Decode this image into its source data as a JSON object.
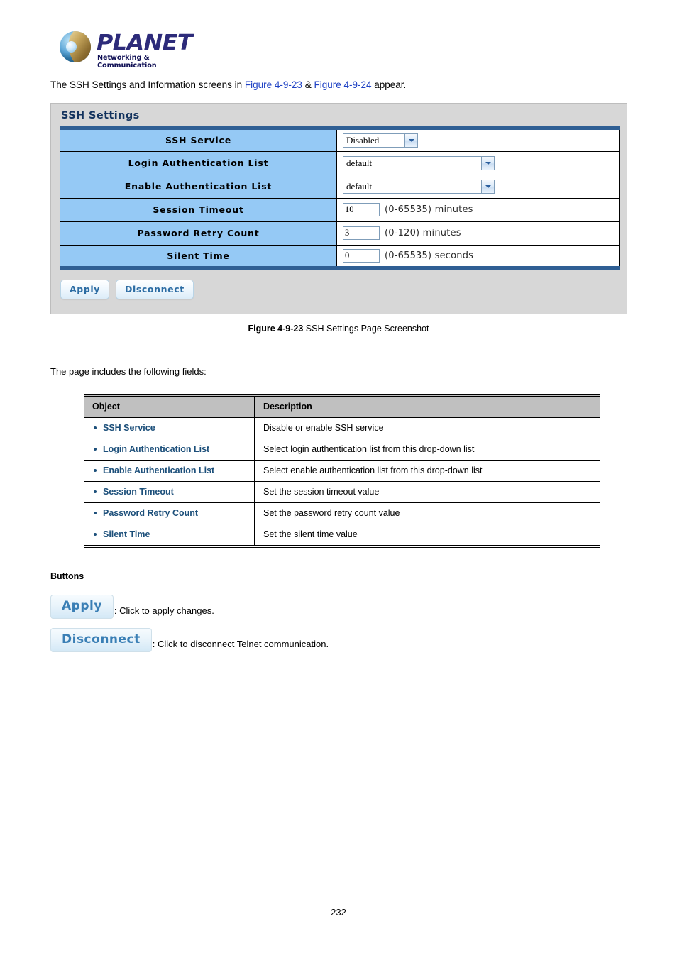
{
  "logo": {
    "brand": "PLANET",
    "tagline": "Networking & Communication",
    "icon": "planet-globe-icon"
  },
  "intro": {
    "text_before": "The SSH Settings and Information screens in ",
    "link1": "Figure 4-9-23",
    "separator": " & ",
    "link2": "Figure 4-9-24",
    "text_after": " appear.",
    "link_color": "#1f42c4"
  },
  "panel": {
    "title": "SSH Settings",
    "accent_color": "#2f5f94",
    "row_label_bg": "#95c9f5",
    "rows": [
      {
        "label": "SSH Service",
        "control": "select",
        "value": "Disabled",
        "hint": ""
      },
      {
        "label": "Login Authentication List",
        "control": "select",
        "value": "default",
        "hint": ""
      },
      {
        "label": "Enable Authentication List",
        "control": "select",
        "value": "default",
        "hint": ""
      },
      {
        "label": "Session Timeout",
        "control": "input",
        "value": "10",
        "hint": "(0-65535) minutes"
      },
      {
        "label": "Password Retry Count",
        "control": "input",
        "value": "3",
        "hint": "(0-120) minutes"
      },
      {
        "label": "Silent Time",
        "control": "input",
        "value": "0",
        "hint": "(0-65535) seconds"
      }
    ],
    "buttons": {
      "apply": "Apply",
      "disconnect": "Disconnect"
    }
  },
  "figure_caption": {
    "label": "Figure 4-9-23",
    "text": " SSH Settings Page Screenshot"
  },
  "body_line": "The page includes the following fields:",
  "desc_table": {
    "headers": [
      "Object",
      "Description"
    ],
    "rows": [
      {
        "object": "SSH Service",
        "description": "Disable or enable SSH service"
      },
      {
        "object": "Login Authentication List",
        "description": "Select login authentication list from this drop-down list"
      },
      {
        "object": "Enable Authentication List",
        "description": "Select enable authentication list from this drop-down list"
      },
      {
        "object": "Session Timeout",
        "description": "Set the session timeout value"
      },
      {
        "object": "Password Retry Count",
        "description": "Set the password retry count value"
      },
      {
        "object": "Silent Time",
        "description": "Set the silent time value"
      }
    ]
  },
  "buttons_section": {
    "heading": "Buttons",
    "items": [
      {
        "label": "Apply",
        "description": ": Click to apply changes."
      },
      {
        "label": "Disconnect",
        "description": ": Click to disconnect Telnet communication."
      }
    ]
  },
  "page_number": "232"
}
